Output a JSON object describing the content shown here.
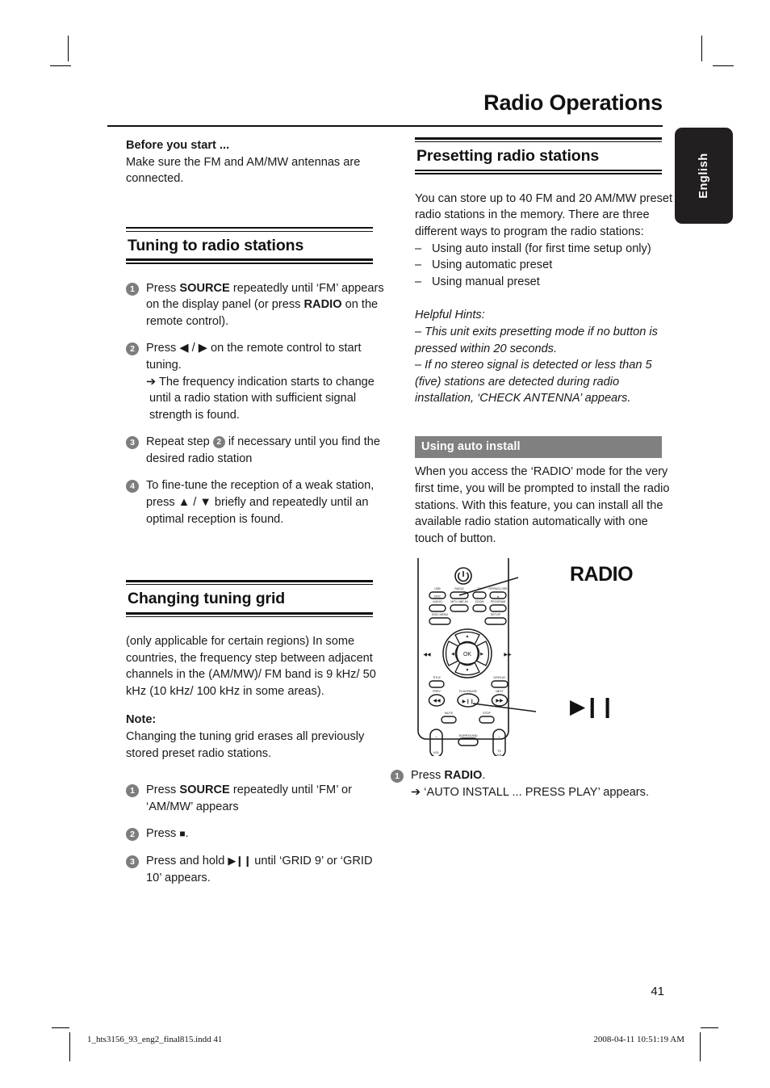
{
  "page": {
    "title": "Radio Operations",
    "language_tab": "English",
    "page_number": "41"
  },
  "left_column": {
    "before_you_start": {
      "heading": "Before you start ...",
      "body": "Make sure the FM and AM/MW antennas are connected."
    },
    "tuning": {
      "heading": "Tuning to radio stations",
      "steps": [
        {
          "num": "1",
          "text_parts": [
            "Press ",
            "SOURCE",
            " repeatedly until ‘FM’ appears on the display panel (or press ",
            "RADIO",
            " on the remote control)."
          ]
        },
        {
          "num": "2",
          "text": "Press ◀ / ▶ on the remote control to start tuning.",
          "result": "➔ The frequency indication starts to change until a radio station with sufficient signal strength is found."
        },
        {
          "num": "3",
          "text_before": "Repeat step ",
          "inline_num": "2",
          "text_after": " if necessary until you find the desired radio station"
        },
        {
          "num": "4",
          "text": "To fine-tune the reception of a weak station, press ▲ / ▼ briefly and repeatedly until an optimal reception is found."
        }
      ]
    },
    "grid": {
      "heading": "Changing tuning grid",
      "body": "(only applicable for certain regions) In some countries, the frequency step between adjacent channels in the (AM/MW)/ FM band is 9 kHz/ 50 kHz (10 kHz/ 100 kHz in some areas).",
      "note_label": "Note:",
      "note_body": "Changing the tuning grid erases all previously stored preset radio stations.",
      "steps": [
        {
          "num": "1",
          "text_parts": [
            "Press ",
            "SOURCE",
            " repeatedly until ‘FM’ or ‘AM/MW’ appears"
          ]
        },
        {
          "num": "2",
          "text_before": "Press ",
          "glyph": "■",
          "text_after": "."
        },
        {
          "num": "3",
          "text_before": "Press and hold ",
          "glyph": "▶❙❙",
          "text_after": " until ‘GRID 9’ or ‘GRID 10’ appears."
        }
      ]
    }
  },
  "right_column": {
    "presetting": {
      "heading": "Presetting radio stations",
      "body": "You can store up to 40 FM and 20 AM/MW preset radio stations in the memory. There are three different ways to program the radio stations:",
      "bullets": [
        "Using auto install (for first time setup only)",
        "Using automatic preset",
        "Using manual preset"
      ],
      "hints_label": "Helpful Hints:",
      "hints": [
        "– This unit exits presetting mode if no button is pressed within 20 seconds.",
        "– If no stereo signal is detected or less than 5 (five) stations are detected during radio installation, ‘CHECK ANTENNA’ appears."
      ]
    },
    "auto_install": {
      "bar_label": "Using auto install",
      "body": "When you access the ‘RADIO’ mode for the very first time, you will be prompted to install the radio stations.  With this feature, you can install all the available radio station automatically with one touch of button.",
      "figure": {
        "callout_radio": "RADIO",
        "callout_play_pause": "▶❙❙",
        "remote_buttons": {
          "row1": [
            "USB",
            "RADIO",
            "TV",
            "OPEN/CLOSE"
          ],
          "row2": [
            "AUDIO",
            "MP3 LINE-IN",
            "ZOOM",
            "PROGRAM"
          ],
          "row3": [
            "DISC MENU",
            "SETUP"
          ],
          "center": "OK",
          "row4": [
            "TITLE",
            "DISPLAY"
          ],
          "row5": [
            "PREV",
            "PLAY/PAUSE",
            "NEXT"
          ],
          "row6": [
            "MUTE",
            "STOP"
          ],
          "row7": [
            "VOL",
            "SURROUND",
            "TV VOL"
          ]
        }
      },
      "steps": [
        {
          "num": "1",
          "text_before": "Press ",
          "bold": "RADIO",
          "text_after": ".",
          "result": "➔ ‘AUTO INSTALL ... PRESS PLAY’ appears."
        }
      ]
    }
  },
  "footer": {
    "file": "1_hts3156_93_eng2_final815.indd   41",
    "date": "2008-04-11   10:51:19 AM"
  }
}
